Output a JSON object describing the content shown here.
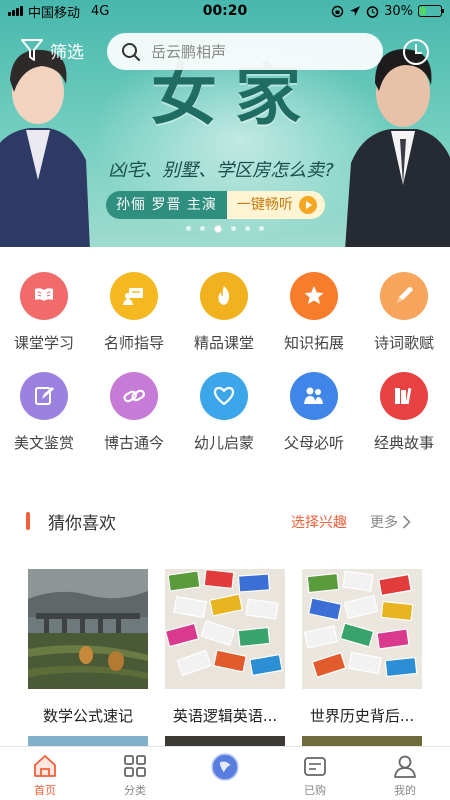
{
  "status_bar": {
    "carrier": "中国移动",
    "network": "4G",
    "time": "00:20",
    "battery": "30%",
    "battery_level": 0.3
  },
  "banner": {
    "title": "女家",
    "subtitle": "凶宅、别墅、学区房怎么卖?",
    "cast": "孙俪 罗晋 主演",
    "cta": "一键畅听",
    "active_slide": 3,
    "slide_count": 6
  },
  "nav": {
    "filter_label": "筛选",
    "search_placeholder": "岳云鹏相声"
  },
  "categories": [
    {
      "label": "课堂学习",
      "icon": "book-icon",
      "color": "#f26b6b"
    },
    {
      "label": "名师指导",
      "icon": "teacher-icon",
      "color": "#f5b820"
    },
    {
      "label": "精品课堂",
      "icon": "flame-icon",
      "color": "#f2b11f"
    },
    {
      "label": "知识拓展",
      "icon": "star-icon",
      "color": "#f77d2d"
    },
    {
      "label": "诗词歌赋",
      "icon": "pen-icon",
      "color": "#f7a55c"
    },
    {
      "label": "美文鉴赏",
      "icon": "edit-icon",
      "color": "#9b82e0"
    },
    {
      "label": "博古通今",
      "icon": "link-icon",
      "color": "#c67bd6"
    },
    {
      "label": "幼儿启蒙",
      "icon": "heart-icon",
      "color": "#3ba7ea"
    },
    {
      "label": "父母必听",
      "icon": "parents-icon",
      "color": "#3f86e8"
    },
    {
      "label": "经典故事",
      "icon": "books-icon",
      "color": "#e84141"
    }
  ],
  "guess": {
    "title": "猜你喜欢",
    "pick_label": "选择兴趣",
    "more_label": "更多"
  },
  "cards": [
    {
      "title": "数学公式速记"
    },
    {
      "title": "英语逻辑英语..."
    },
    {
      "title": "世界历史背后..."
    }
  ],
  "tabs": [
    {
      "label": "首页",
      "icon": "home-icon"
    },
    {
      "label": "分类",
      "icon": "grid-icon"
    },
    {
      "label": "",
      "icon": "player-icon"
    },
    {
      "label": "已购",
      "icon": "purchased-icon"
    },
    {
      "label": "我的",
      "icon": "profile-icon"
    }
  ],
  "colors": {
    "accent": "#f0603a",
    "banner": "#47b7ad"
  }
}
